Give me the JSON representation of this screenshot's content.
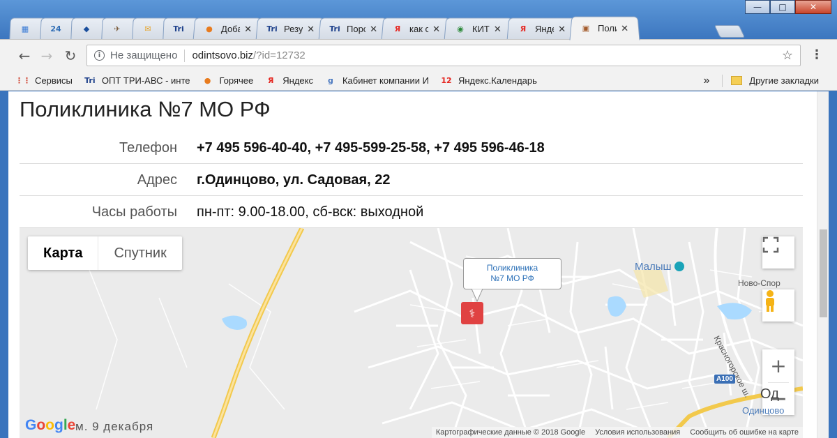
{
  "window": {
    "minimize": "—",
    "maximize": "□",
    "close": "✕"
  },
  "tabs": [
    {
      "label": "",
      "icon": "calendar-icon",
      "color": "#3a7bd5",
      "glyph": "▦"
    },
    {
      "label": "",
      "icon": "24-icon",
      "color": "#2f6db5",
      "glyph": "24"
    },
    {
      "label": "",
      "icon": "domino-icon",
      "color": "#1a4e9c",
      "glyph": "◆"
    },
    {
      "label": "",
      "icon": "bird-icon",
      "color": "#7a5a3a",
      "glyph": "✈"
    },
    {
      "label": "",
      "icon": "mail-icon",
      "color": "#e6a020",
      "glyph": "✉"
    },
    {
      "label": "",
      "icon": "triabc-icon",
      "color": "#1c3f8a",
      "glyph": "Tri"
    },
    {
      "label": "Доба",
      "icon": "orange-icon",
      "color": "#e87b1e",
      "glyph": "●"
    },
    {
      "label": "Резул",
      "icon": "triabc-icon",
      "color": "#1c3f8a",
      "glyph": "Tri"
    },
    {
      "label": "Порс",
      "icon": "triabc-icon",
      "color": "#1c3f8a",
      "glyph": "Tri"
    },
    {
      "label": "как с",
      "icon": "yandex-icon",
      "color": "#e52620",
      "glyph": "Я"
    },
    {
      "label": "КИТ",
      "icon": "kit-icon",
      "color": "#2c8a3a",
      "glyph": "◉"
    },
    {
      "label": "Янде",
      "icon": "yandex-icon",
      "color": "#e52620",
      "glyph": "Я"
    },
    {
      "label": "Поли",
      "icon": "briefcase-icon",
      "color": "#a35a2a",
      "glyph": "▣",
      "active": true
    }
  ],
  "toolbar": {
    "security_text": "Не защищено",
    "url_host": "odintsovo.biz",
    "url_path": "/?id=12732"
  },
  "bookmarks": [
    {
      "label": "Сервисы",
      "icon": "apps-grid-icon",
      "color": "#d14836",
      "glyph": "⋮⋮"
    },
    {
      "label": "ОПТ ТРИ-АВС - инте",
      "icon": "triabc-icon",
      "color": "#1c3f8a",
      "glyph": "Tri"
    },
    {
      "label": "Горячее",
      "icon": "orange-icon",
      "color": "#e87b1e",
      "glyph": "●"
    },
    {
      "label": "Яндекс",
      "icon": "yandex-icon",
      "color": "#e52620",
      "glyph": "Я"
    },
    {
      "label": "Кабинет компании И",
      "icon": "g-icon",
      "color": "#4a78c0",
      "glyph": "g"
    },
    {
      "label": "Яндекс.Календарь",
      "icon": "calendar-12-icon",
      "color": "#e52620",
      "glyph": "12"
    }
  ],
  "bookmarks_more": "»",
  "other_bookmarks": "Другие закладки",
  "page": {
    "title": "Поликлиника №7 МО РФ",
    "rows": [
      {
        "key": "Телефон",
        "value": "+7 495 596-40-40, +7 495-599-25-58, +7 495 596-46-18",
        "bold": true
      },
      {
        "key": "Адрес",
        "value": "г.Одинцово, ул. Садовая, 22",
        "bold": true
      },
      {
        "key": "Часы работы",
        "value": "пн-пт: 9.00-18.00, сб-вск: выходной",
        "bold": false
      }
    ]
  },
  "map": {
    "type_map": "Карта",
    "type_satellite": "Спутник",
    "bubble_line1": "Поликлиника",
    "bubble_line2": "№7 МО РФ",
    "poi_malysh": "Малыш",
    "road_novo": "Ново-Спор",
    "road_krasnogorsk": "Красногорское ш.",
    "badge_a100": "A100",
    "city_short": "Од",
    "city_full": "Одинцово",
    "zoom_in": "+",
    "zoom_out": "—",
    "google": [
      "G",
      "o",
      "o",
      "g",
      "l",
      "e"
    ],
    "google_colors": [
      "#4285f4",
      "#ea4335",
      "#fbbc05",
      "#4285f4",
      "#34a853",
      "#ea4335"
    ],
    "date_text": "м. 9 декабря",
    "attr_data": "Картографические данные © 2018 Google",
    "attr_terms": "Условия использования",
    "attr_report": "Сообщить об ошибке на карте"
  }
}
